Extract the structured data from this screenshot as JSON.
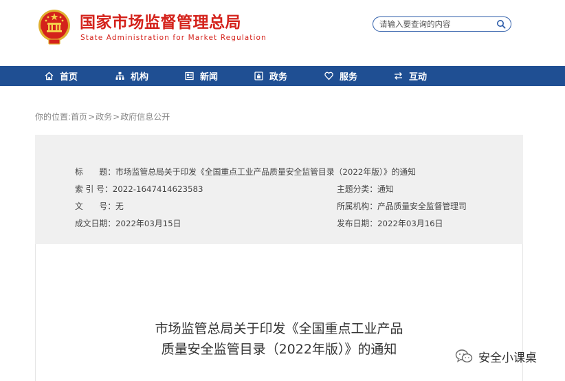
{
  "header": {
    "title_cn": "国家市场监督管理总局",
    "title_en": "State Administration for Market Regulation",
    "search_placeholder": "请输入要查询的内容"
  },
  "nav": {
    "items": [
      {
        "label": "首页",
        "icon": "home-icon"
      },
      {
        "label": "机构",
        "icon": "org-chart-icon"
      },
      {
        "label": "新闻",
        "icon": "news-icon"
      },
      {
        "label": "政务",
        "icon": "government-affairs-icon"
      },
      {
        "label": "服务",
        "icon": "heart-icon"
      },
      {
        "label": "互动",
        "icon": "exchange-arrows-icon"
      }
    ]
  },
  "breadcrumb": {
    "prefix": "你的位置:",
    "items": [
      "首页",
      "政务",
      "政府信息公开"
    ]
  },
  "meta": {
    "title_label": "标　　题：",
    "title_value": "市场监管总局关于印发《全国重点工业产品质量安全监管目录（2022年版）》的通知",
    "index_label": "索 引 号：",
    "index_value": "2022-1647414623583",
    "category_label": "主题分类：",
    "category_value": "通知",
    "docno_label": "文　　号：",
    "docno_value": "无",
    "org_label": "所属机构：",
    "org_value": "产品质量安全监督管理司",
    "created_label": "成文日期：",
    "created_value": "2022年03月15日",
    "published_label": "发布日期：",
    "published_value": "2022年03月16日"
  },
  "document": {
    "heading_line1": "市场监管总局关于印发《全国重点工业产品",
    "heading_line2": "质量安全监管目录（2022年版）》的通知"
  },
  "watermark": {
    "text": "安全小课桌",
    "icon": "chat-bubble-icon"
  },
  "colors": {
    "brand_red": "#d4221b",
    "nav_blue": "#1f4f93",
    "panel_gray": "#f0f0f0"
  }
}
